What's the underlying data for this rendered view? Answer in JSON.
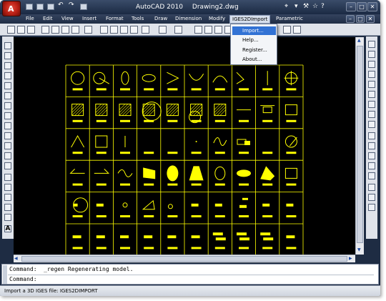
{
  "window": {
    "app_name": "AutoCAD 2010",
    "document": "Drawing2.dwg"
  },
  "menubar": {
    "items": [
      "File",
      "Edit",
      "View",
      "Insert",
      "Format",
      "Tools",
      "Draw",
      "Dimension",
      "Modify",
      "IGES2DImport",
      "Parametric"
    ],
    "active": "IGES2DImport"
  },
  "dropdown": {
    "items": [
      "Import...",
      "Help...",
      "Register...",
      "About..."
    ],
    "highlighted": "Import..."
  },
  "command": {
    "history": "Command:  _regen Regenerating model.",
    "prompt": "Command:"
  },
  "statusbar": {
    "text": "Import a 3D IGES file: IGES2DIMPORT"
  },
  "colors": {
    "drawing_background": "#000000",
    "entity_color": "#ffff00",
    "menu_highlight": "#3272d4"
  },
  "icons": {
    "app_menu": "autocad-logo-icon",
    "search": "binoculars-icon",
    "help": "help-icon"
  }
}
